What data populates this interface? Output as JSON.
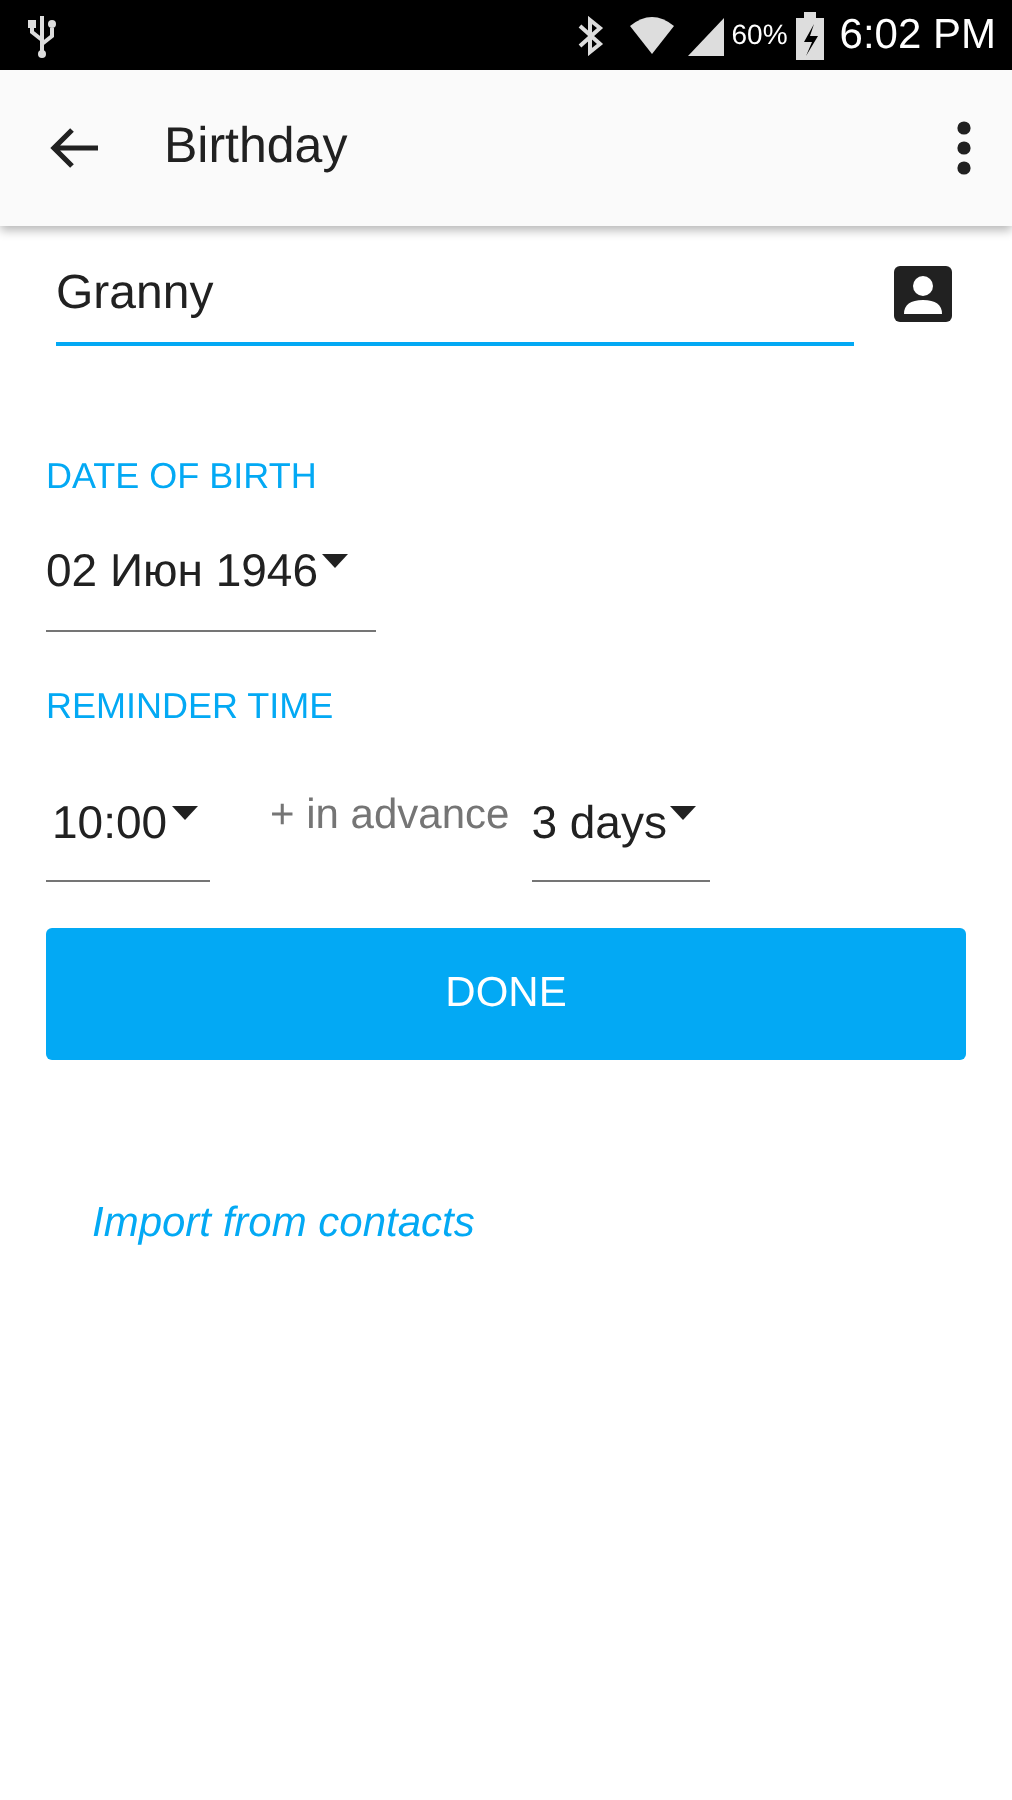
{
  "status_bar": {
    "battery": "60%",
    "time": "6:02 PM"
  },
  "app_bar": {
    "title": "Birthday"
  },
  "name_field": {
    "value": "Granny",
    "focused": true
  },
  "date_of_birth": {
    "label": "DATE OF BIRTH",
    "value": "02 Июн 1946"
  },
  "reminder": {
    "label": "REMINDER TIME",
    "time": "10:00",
    "advance_label": "+ in advance",
    "advance": "3 days"
  },
  "done_button": {
    "label": "DONE"
  },
  "import_link": {
    "label": "Import from contacts"
  }
}
